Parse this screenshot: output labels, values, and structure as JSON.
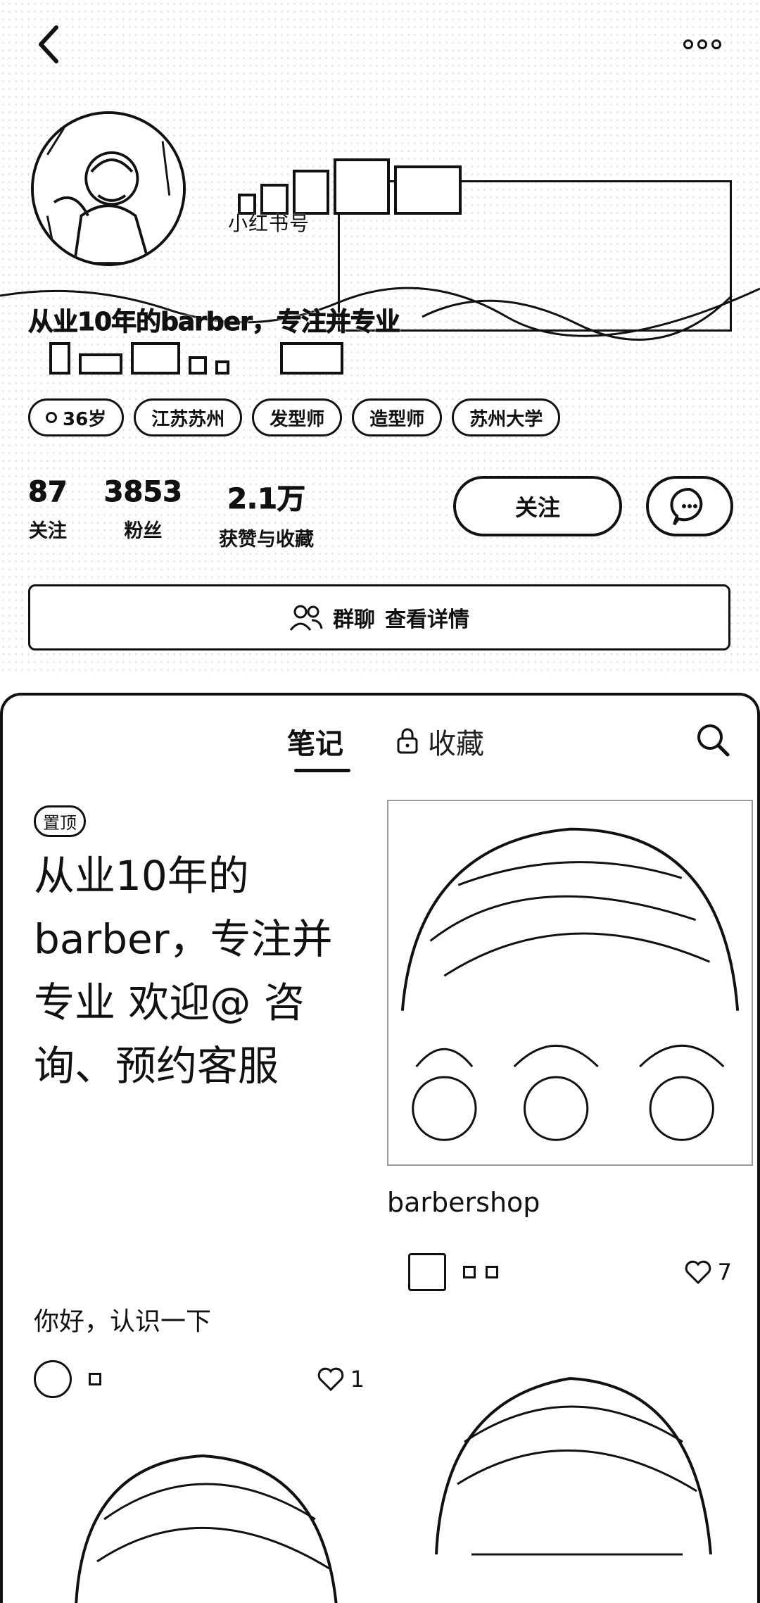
{
  "header": {
    "back_icon": "chevron-left-icon",
    "more_icon": "more-dots-icon",
    "platform_id": "小红书号",
    "bio": "从业10年的barber，专注并专业",
    "tags": [
      {
        "label": "36岁",
        "icon": "gender-icon"
      },
      {
        "label": "江苏苏州"
      },
      {
        "label": "发型师"
      },
      {
        "label": "造型师"
      },
      {
        "label": "苏州大学"
      }
    ],
    "stats": [
      {
        "value": "87",
        "label": "关注"
      },
      {
        "value": "3853",
        "label": "粉丝"
      },
      {
        "value": "2.1万",
        "label": "获赞与收藏"
      }
    ],
    "follow_label": "关注",
    "group": {
      "label": "群聊",
      "action": "查看详情"
    }
  },
  "tabs": {
    "notes": "笔记",
    "favorites": "收藏"
  },
  "notes": {
    "pinned_badge": "置顶",
    "pinned_title": "从业10年的barber，专注并专业 欢迎@ 咨询、预约客服",
    "left_note_title": "你好，认识一下",
    "left_note_likes": "1",
    "right_note_caption": "barbershop",
    "right_note_likes": "7"
  },
  "colors": {
    "ink": "#111111",
    "background": "#ffffff"
  }
}
